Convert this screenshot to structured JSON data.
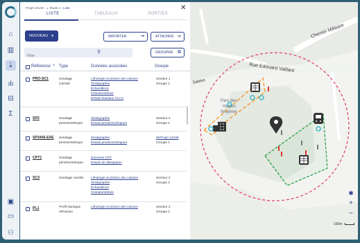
{
  "breadcrumb": {
    "project": "Projet 10149",
    "study": "Étude 1",
    "current": "Liste"
  },
  "tabs": [
    {
      "label": "LISTE"
    },
    {
      "label": "TABLEAUX"
    },
    {
      "label": "SORTIES"
    }
  ],
  "toolbar": {
    "new_label": "NOUVEAU",
    "import_label": "IMPORTER",
    "attach_label": "ATTACHER",
    "group_label": "GROUPER"
  },
  "filter": {
    "placeholder": "Filter"
  },
  "table": {
    "headers": {
      "reference": "Référence",
      "type": "Type",
      "assoc": "Données associées",
      "group": "Groupe"
    },
    "rows": [
      {
        "ref": "PRO-SC1",
        "type": [
          "Sondage",
          "Carotté"
        ],
        "assoc": [
          "Lithologie et photos des caisses",
          "Stratigraphie",
          "Échantillons",
          "Granulométries",
          "Essais triaxiaux CU+u"
        ],
        "group": [
          "Secteur 1",
          "Groupe 1"
        ]
      },
      {
        "ref": "SP2",
        "type": [
          "Sondage",
          "pressiométrique"
        ],
        "assoc": [
          "Stratigraphie",
          "Essais pressiométriques"
        ],
        "group": [
          "Secteur 2",
          "Groupe 1"
        ]
      },
      {
        "ref": "SP3456-EXE",
        "type": [
          "Sondage",
          "pressiométrique"
        ],
        "assoc": [
          "Stratigraphie",
          "Essais pressiométriques"
        ],
        "group": [
          "deProjet 12345",
          "Groupe 1"
        ]
      },
      {
        "ref": "CPT1",
        "type": [
          "Sondage",
          "pénétrométrique"
        ],
        "assoc": [
          "Données CPT",
          "Essais de dissipation"
        ],
        "group": []
      },
      {
        "ref": "SC3",
        "type": [
          "Sondage carotté"
        ],
        "assoc": [
          "Lithologie et photos des caisses",
          "Stratigraphie",
          "Échantillons",
          "Granulométries"
        ],
        "group": [
          "Secteur 2",
          "Groupe 2"
        ]
      },
      {
        "ref": "PL1",
        "type": [
          "Profil sismique",
          "réfraction"
        ],
        "assoc": [
          "Lithologie et photos des caisses"
        ],
        "group": [
          "Secteur 2",
          "Groupe 2"
        ]
      }
    ]
  },
  "map": {
    "streets": {
      "chemin": "Chemin Militaire",
      "rue": "Rue Edouard Vaillant",
      "sables": "Sables"
    },
    "park_label": [
      "Parc des",
      "Hautes",
      "Bruyères"
    ],
    "scale_label": "100m",
    "colors": {
      "circle": "#e0457a",
      "orange_zone": "#f29a2e",
      "green_zone": "#2aa14a",
      "cyan_marker": "#3ab7c7",
      "pin": "#333333"
    }
  },
  "colors": {
    "accent": "#2b3f8c",
    "frame": "#2f5f73"
  }
}
